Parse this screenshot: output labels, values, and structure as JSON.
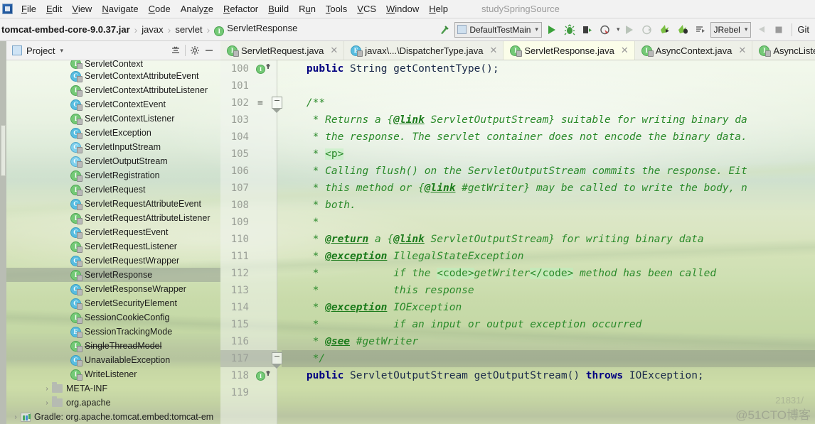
{
  "window": {
    "project_name": "studySpringSource"
  },
  "menubar": {
    "items": [
      {
        "label": "File",
        "mnemonic": "F"
      },
      {
        "label": "Edit",
        "mnemonic": "E"
      },
      {
        "label": "View",
        "mnemonic": "V"
      },
      {
        "label": "Navigate",
        "mnemonic": "N"
      },
      {
        "label": "Code",
        "mnemonic": "C"
      },
      {
        "label": "Analyze",
        "mnemonic": "z"
      },
      {
        "label": "Refactor",
        "mnemonic": "R"
      },
      {
        "label": "Build",
        "mnemonic": "B"
      },
      {
        "label": "Run",
        "mnemonic": "u"
      },
      {
        "label": "Tools",
        "mnemonic": "T"
      },
      {
        "label": "VCS",
        "mnemonic": "V"
      },
      {
        "label": "Window",
        "mnemonic": "W"
      },
      {
        "label": "Help",
        "mnemonic": "H"
      }
    ]
  },
  "navbar": {
    "breadcrumbs": [
      {
        "label": "tomcat-embed-core-9.0.37.jar",
        "bold": true,
        "icon": null
      },
      {
        "label": "javax",
        "bold": false,
        "icon": null
      },
      {
        "label": "servlet",
        "bold": false,
        "icon": null
      },
      {
        "label": "ServletResponse",
        "bold": false,
        "icon": "interface-badge"
      }
    ],
    "separator": "›",
    "run_config": "DefaultTestMain",
    "jrebel_label": "JRebel",
    "git_label": "Git",
    "icons": [
      "build-hammer-icon",
      "run-icon",
      "debug-icon",
      "run-with-coverage-icon",
      "profile-icon",
      "rerun-icon",
      "attach-debugger-icon",
      "jrebel-run-icon",
      "jrebel-debug-icon",
      "jrebel-more-icon",
      "update-app-icon",
      "stop-icon"
    ]
  },
  "tabs": [
    {
      "label": "ServletRequest.java",
      "kind": "interface",
      "active": false,
      "closable": true
    },
    {
      "label": "javax\\...\\DispatcherType.java",
      "kind": "enum",
      "active": false,
      "closable": true
    },
    {
      "label": "ServletResponse.java",
      "kind": "interface",
      "active": true,
      "closable": true
    },
    {
      "label": "AsyncContext.java",
      "kind": "interface",
      "active": false,
      "closable": true
    },
    {
      "label": "AsyncListener.java",
      "kind": "interface",
      "active": false,
      "closable": false
    }
  ],
  "project_panel": {
    "title": "Project",
    "caret": "▾",
    "collapse_all_icon": "collapse-all-icon",
    "settings_icon": "gear-icon",
    "hide_icon": "minimize-icon",
    "tree": [
      {
        "label": "ServletContext",
        "kind": "interface",
        "indent": 1,
        "selected": false,
        "clipped": true
      },
      {
        "label": "ServletContextAttributeEvent",
        "kind": "class",
        "indent": 1,
        "selected": false
      },
      {
        "label": "ServletContextAttributeListener",
        "kind": "interface",
        "indent": 1,
        "selected": false
      },
      {
        "label": "ServletContextEvent",
        "kind": "class",
        "indent": 1,
        "selected": false
      },
      {
        "label": "ServletContextListener",
        "kind": "interface",
        "indent": 1,
        "selected": false
      },
      {
        "label": "ServletException",
        "kind": "class",
        "indent": 1,
        "selected": false
      },
      {
        "label": "ServletInputStream",
        "kind": "abstract",
        "indent": 1,
        "selected": false
      },
      {
        "label": "ServletOutputStream",
        "kind": "abstract",
        "indent": 1,
        "selected": false
      },
      {
        "label": "ServletRegistration",
        "kind": "interface",
        "indent": 1,
        "selected": false
      },
      {
        "label": "ServletRequest",
        "kind": "interface",
        "indent": 1,
        "selected": false
      },
      {
        "label": "ServletRequestAttributeEvent",
        "kind": "class",
        "indent": 1,
        "selected": false
      },
      {
        "label": "ServletRequestAttributeListener",
        "kind": "interface",
        "indent": 1,
        "selected": false
      },
      {
        "label": "ServletRequestEvent",
        "kind": "class",
        "indent": 1,
        "selected": false
      },
      {
        "label": "ServletRequestListener",
        "kind": "interface",
        "indent": 1,
        "selected": false
      },
      {
        "label": "ServletRequestWrapper",
        "kind": "class",
        "indent": 1,
        "selected": false
      },
      {
        "label": "ServletResponse",
        "kind": "interface",
        "indent": 1,
        "selected": true
      },
      {
        "label": "ServletResponseWrapper",
        "kind": "class",
        "indent": 1,
        "selected": false
      },
      {
        "label": "ServletSecurityElement",
        "kind": "class",
        "indent": 1,
        "selected": false
      },
      {
        "label": "SessionCookieConfig",
        "kind": "interface",
        "indent": 1,
        "selected": false
      },
      {
        "label": "SessionTrackingMode",
        "kind": "enum",
        "indent": 1,
        "selected": false
      },
      {
        "label": "SingleThreadModel",
        "kind": "interface",
        "indent": 1,
        "selected": false,
        "deprecated": true
      },
      {
        "label": "UnavailableException",
        "kind": "class",
        "indent": 1,
        "selected": false
      },
      {
        "label": "WriteListener",
        "kind": "interface",
        "indent": 1,
        "selected": false
      },
      {
        "label": "META-INF",
        "kind": "folder",
        "indent": 0,
        "selected": false,
        "arrow": "›"
      },
      {
        "label": "org.apache",
        "kind": "folder",
        "indent": 0,
        "selected": false,
        "arrow": "›"
      },
      {
        "label": "Gradle: org.apache.tomcat.embed:tomcat-em",
        "kind": "library",
        "indent": -1,
        "selected": false,
        "arrow": "›"
      }
    ]
  },
  "editor": {
    "file": "ServletResponse.java",
    "first_line": 100,
    "current_line": 117,
    "gutter_marks": {
      "100": "implemented-method-icon",
      "102": "javadoc-render-icon",
      "118": "implemented-method-icon"
    },
    "fold_markers": [
      102,
      117
    ],
    "lines": [
      {
        "n": 100,
        "tokens": [
          {
            "t": "    ",
            "c": "plain"
          },
          {
            "t": "public",
            "c": "kw"
          },
          {
            "t": " String getContentType();",
            "c": "ident"
          }
        ]
      },
      {
        "n": 101,
        "tokens": []
      },
      {
        "n": 102,
        "tokens": [
          {
            "t": "    /**",
            "c": "doc"
          }
        ]
      },
      {
        "n": 103,
        "tokens": [
          {
            "t": "     * Returns a {",
            "c": "doc"
          },
          {
            "t": "@link",
            "c": "doctag"
          },
          {
            "t": " ServletOutputStream} suitable for writing binary da",
            "c": "doc"
          }
        ]
      },
      {
        "n": 104,
        "tokens": [
          {
            "t": "     * the response. The servlet container does not encode the binary data.",
            "c": "doc"
          }
        ]
      },
      {
        "n": 105,
        "tokens": [
          {
            "t": "     * ",
            "c": "doc"
          },
          {
            "t": "<p>",
            "c": "docmark"
          }
        ]
      },
      {
        "n": 106,
        "tokens": [
          {
            "t": "     * Calling flush() on the ServletOutputStream commits the response. Eit",
            "c": "doc"
          }
        ]
      },
      {
        "n": 107,
        "tokens": [
          {
            "t": "     * this method or {",
            "c": "doc"
          },
          {
            "t": "@link",
            "c": "doctag"
          },
          {
            "t": " #getWriter} may be called to write the body, n",
            "c": "doc"
          }
        ]
      },
      {
        "n": 108,
        "tokens": [
          {
            "t": "     * both.",
            "c": "doc"
          }
        ]
      },
      {
        "n": 109,
        "tokens": [
          {
            "t": "     *",
            "c": "doc"
          }
        ]
      },
      {
        "n": 110,
        "tokens": [
          {
            "t": "     * ",
            "c": "doc"
          },
          {
            "t": "@return",
            "c": "doctag"
          },
          {
            "t": " a {",
            "c": "doc"
          },
          {
            "t": "@link",
            "c": "doctag"
          },
          {
            "t": " ServletOutputStream} for writing binary data",
            "c": "doc"
          }
        ]
      },
      {
        "n": 111,
        "tokens": [
          {
            "t": "     * ",
            "c": "doc"
          },
          {
            "t": "@exception",
            "c": "doctag"
          },
          {
            "t": " IllegalStateException",
            "c": "doc"
          }
        ]
      },
      {
        "n": 112,
        "tokens": [
          {
            "t": "     *            if the ",
            "c": "doc"
          },
          {
            "t": "<code>",
            "c": "docmark"
          },
          {
            "t": "getWriter",
            "c": "doc"
          },
          {
            "t": "</code>",
            "c": "docmark"
          },
          {
            "t": " method has been called",
            "c": "doc"
          }
        ]
      },
      {
        "n": 113,
        "tokens": [
          {
            "t": "     *            this response",
            "c": "doc"
          }
        ]
      },
      {
        "n": 114,
        "tokens": [
          {
            "t": "     * ",
            "c": "doc"
          },
          {
            "t": "@exception",
            "c": "doctag"
          },
          {
            "t": " IOException",
            "c": "doc"
          }
        ]
      },
      {
        "n": 115,
        "tokens": [
          {
            "t": "     *            if an input or output exception occurred",
            "c": "doc"
          }
        ]
      },
      {
        "n": 116,
        "tokens": [
          {
            "t": "     * ",
            "c": "doc"
          },
          {
            "t": "@see",
            "c": "doctag"
          },
          {
            "t": " #getWriter",
            "c": "doc"
          }
        ]
      },
      {
        "n": 117,
        "tokens": [
          {
            "t": "     */",
            "c": "doc"
          }
        ]
      },
      {
        "n": 118,
        "tokens": [
          {
            "t": "    ",
            "c": "plain"
          },
          {
            "t": "public",
            "c": "kw"
          },
          {
            "t": " ServletOutputStream getOutputStream() ",
            "c": "ident"
          },
          {
            "t": "throws",
            "c": "kw"
          },
          {
            "t": " IOException;",
            "c": "ident"
          }
        ]
      },
      {
        "n": 119,
        "tokens": []
      }
    ]
  },
  "watermark": {
    "text": "@51CTO博客",
    "secondary": "21831/"
  },
  "colors": {
    "interface_green": "#74c976",
    "class_blue": "#58bde0",
    "keyword_navy": "#000080",
    "javadoc_green": "#2a8a2a",
    "selection_gray": "#969e92"
  }
}
